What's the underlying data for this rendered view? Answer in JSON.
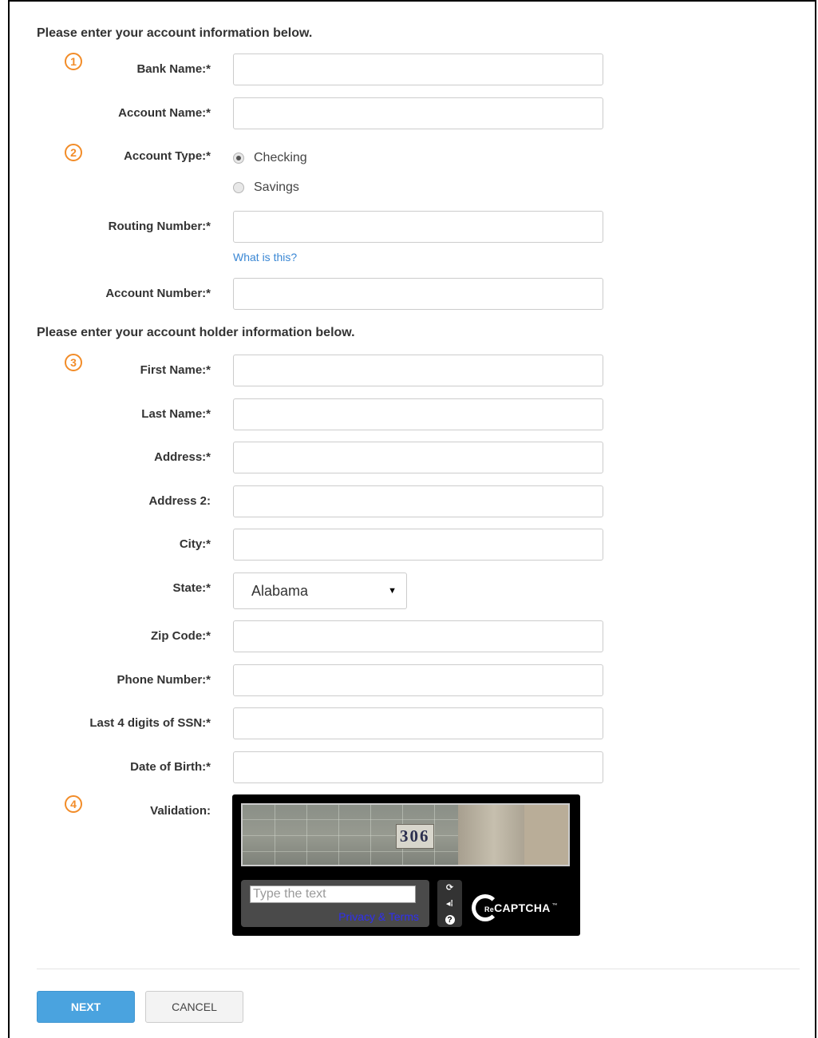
{
  "sections": {
    "account_heading": "Please enter your account information below.",
    "holder_heading": "Please enter your account holder information below."
  },
  "markers": [
    "1",
    "2",
    "3",
    "4"
  ],
  "fields": {
    "bank_name": {
      "label": "Bank Name:*",
      "value": ""
    },
    "account_name": {
      "label": "Account Name:*",
      "value": ""
    },
    "account_type": {
      "label": "Account Type:*",
      "options": [
        "Checking",
        "Savings"
      ],
      "selected": "Checking"
    },
    "routing_number": {
      "label": "Routing Number:*",
      "value": "",
      "help_link": "What is this?"
    },
    "account_number": {
      "label": "Account Number:*",
      "value": ""
    },
    "first_name": {
      "label": "First Name:*",
      "value": ""
    },
    "last_name": {
      "label": "Last Name:*",
      "value": ""
    },
    "address": {
      "label": "Address:*",
      "value": ""
    },
    "address2": {
      "label": "Address 2:",
      "value": ""
    },
    "city": {
      "label": "City:*",
      "value": ""
    },
    "state": {
      "label": "State:*",
      "value": "Alabama"
    },
    "zip": {
      "label": "Zip Code:*",
      "value": ""
    },
    "phone": {
      "label": "Phone Number:*",
      "value": ""
    },
    "ssn4": {
      "label": "Last 4 digits of SSN:*",
      "value": ""
    },
    "dob": {
      "label": "Date of Birth:*",
      "value": ""
    }
  },
  "captcha": {
    "label": "Validation:",
    "challenge_text": "306",
    "placeholder": "Type the text",
    "privacy_link": "Privacy & Terms",
    "brand_prefix": "Re",
    "brand": "CAPTCHA",
    "tm": "™",
    "icons": [
      "refresh-icon",
      "audio-icon",
      "help-icon"
    ]
  },
  "buttons": {
    "next": "NEXT",
    "cancel": "CANCEL"
  },
  "colors": {
    "marker": "#f28c28",
    "link": "#3a87d4",
    "primary": "#4aa3df"
  }
}
